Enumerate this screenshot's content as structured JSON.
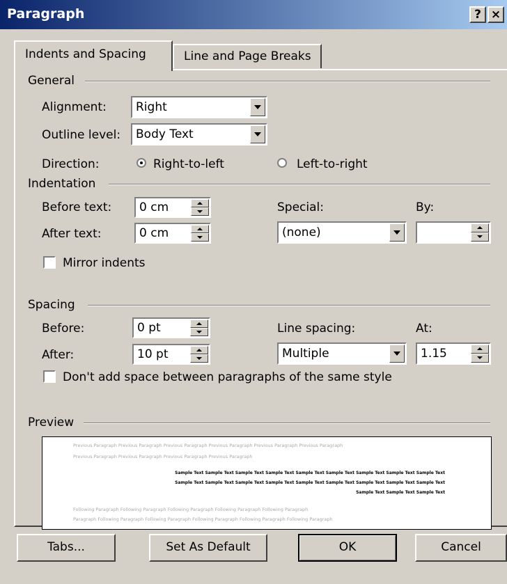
{
  "window": {
    "title": "Paragraph",
    "help_label": "?",
    "close_label": "×"
  },
  "tabs": [
    {
      "label": "Indents and Spacing",
      "active": true
    },
    {
      "label": "Line and Page Breaks",
      "active": false
    }
  ],
  "general": {
    "header": "General",
    "alignment_label": "Alignment:",
    "alignment_value": "Right",
    "outline_label": "Outline level:",
    "outline_value": "Body Text",
    "direction_label": "Direction:",
    "rtl_label": "Right-to-left",
    "ltr_label": "Left-to-right",
    "direction_selected": "Right-to-left"
  },
  "indentation": {
    "header": "Indentation",
    "before_label": "Before text:",
    "before_value": "0 cm",
    "after_label": "After text:",
    "after_value": "0 cm",
    "special_label": "Special:",
    "special_value": "(none)",
    "by_label": "By:",
    "by_value": "",
    "mirror_label": "Mirror indents",
    "mirror_checked": false
  },
  "spacing": {
    "header": "Spacing",
    "before_label": "Before:",
    "before_value": "0 pt",
    "after_label": "After:",
    "after_value": "10 pt",
    "line_spacing_label": "Line spacing:",
    "line_spacing_value": "Multiple",
    "at_label": "At:",
    "at_value": "1.15",
    "dont_add_label": "Don't add space between paragraphs of the same style",
    "dont_add_checked": false
  },
  "preview": {
    "header": "Preview",
    "prev_line1": "Previous Paragraph Previous Paragraph Previous Paragraph Previous Paragraph Previous Paragraph Previous Paragraph",
    "prev_line2": "Previous Paragraph Previous Paragraph Previous Paragraph Previous Paragraph",
    "sample_line1": "Sample Text Sample Text Sample Text Sample Text Sample Text Sample Text Sample Text Sample Text Sample Text",
    "sample_line2": "Sample Text Sample Text Sample Text Sample Text Sample Text Sample Text Sample Text Sample Text Sample Text",
    "sample_line3": "Sample Text Sample Text Sample Text",
    "follow_line1": "Following Paragraph Following Paragraph Following Paragraph Following Paragraph Following Paragraph",
    "follow_line2": "Paragraph Following Paragraph Following Paragraph Following Paragraph Following Paragraph Following Paragraph"
  },
  "buttons": {
    "tabs_label": "Tabs...",
    "default_label": "Set As Default",
    "ok_label": "OK",
    "cancel_label": "Cancel"
  },
  "colors": {
    "titlebar_start": "#0a246a",
    "titlebar_end": "#a6caf0",
    "dialog_bg": "#d4d0c8"
  }
}
